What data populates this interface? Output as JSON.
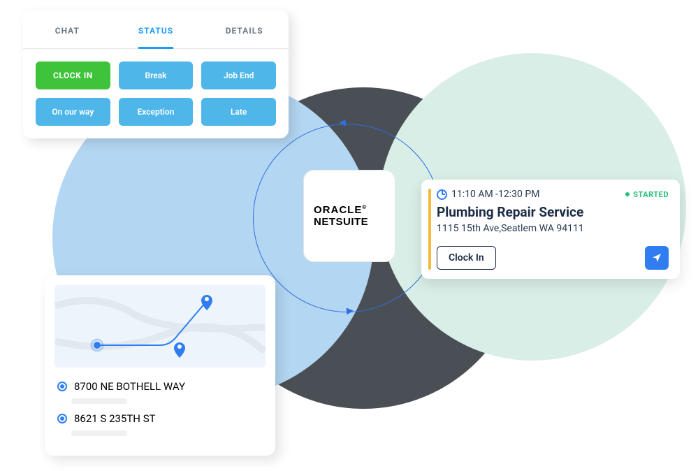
{
  "status_panel": {
    "tabs": {
      "chat": "CHAT",
      "status": "STATUS",
      "details": "DETAILS"
    },
    "active_tab": "STATUS",
    "buttons": {
      "clock_in": "CLOCK IN",
      "break": "Break",
      "job_end": "Job End",
      "on_our_way": "On our way",
      "exception": "Exception",
      "late": "Late"
    }
  },
  "center_logo": {
    "line1": "ORACLE",
    "reg": "®",
    "line2": "NETSUITE"
  },
  "job_card": {
    "time": "11:10 AM -12:30 PM",
    "status": "STARTED",
    "title": "Plumbing Repair Service",
    "address": "1115 15th Ave,Seatlem WA 94111",
    "clock_in_label": "Clock In"
  },
  "map_card": {
    "addresses": [
      "8700 NE BOTHELL WAY",
      "8621 S 235TH ST"
    ]
  },
  "colors": {
    "accent_blue": "#2f7df0",
    "tab_active": "#1e9bff",
    "btn_blue": "#4fb6ea",
    "btn_green": "#3fc33a",
    "status_green": "#27c07b",
    "stripe_yellow": "#f4b942"
  }
}
